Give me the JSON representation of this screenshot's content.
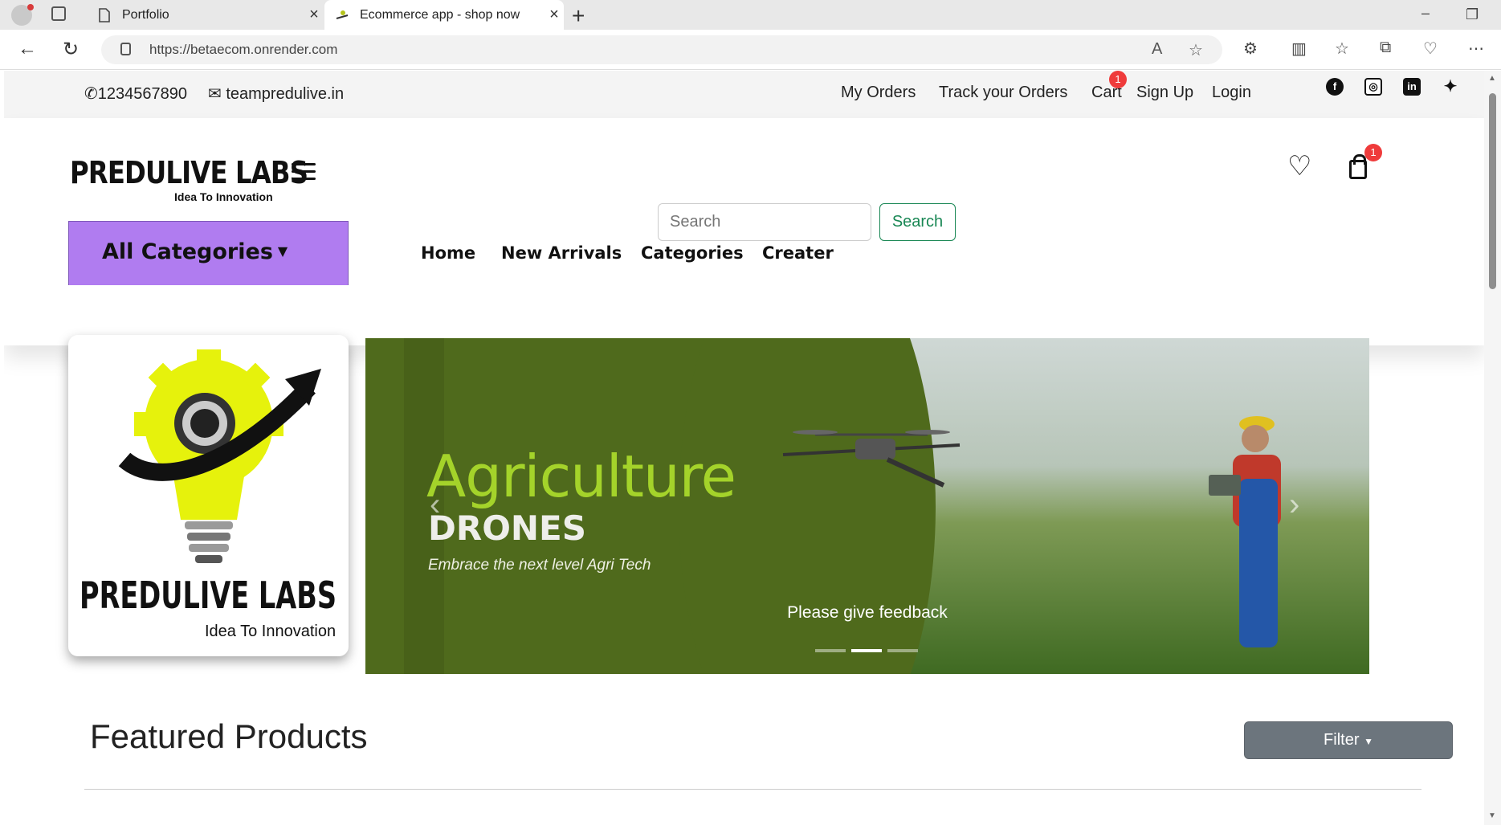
{
  "browser": {
    "tabs": [
      {
        "title": "Portfolio",
        "active": false
      },
      {
        "title": "Ecommerce app - shop now",
        "active": true
      }
    ],
    "url": "https://betaecom.onrender.com"
  },
  "topbar": {
    "phone": "1234567890",
    "email": "teampredulive.in",
    "links": {
      "my_orders": "My Orders",
      "track_orders": "Track your Orders",
      "cart": "Cart",
      "sign_up": "Sign Up",
      "login": "Login"
    },
    "cart_badge": "1",
    "social": [
      "facebook-icon",
      "instagram-icon",
      "linkedin-icon",
      "twitter-icon"
    ]
  },
  "header": {
    "logo_main": "PREDULIVE LABS",
    "logo_sub": "Idea To Innovation",
    "search_placeholder": "Search",
    "search_button": "Search",
    "bag_badge": "1"
  },
  "nav": {
    "all_categories": "All Categories",
    "links": [
      "Home",
      "New Arrivals",
      "Categories",
      "Creater"
    ]
  },
  "hero": {
    "logo_main": "PREDULIVE LABS",
    "logo_sub": "Idea To Innovation",
    "banner_title": "Agriculture",
    "banner_subtitle": "DRONES",
    "banner_tagline": "Embrace the next level Agri Tech",
    "caption": "Please give feedback",
    "active_slide": 2,
    "slide_count": 3
  },
  "featured": {
    "title": "Featured Products",
    "filter_button": "Filter"
  },
  "colors": {
    "accent_purple": "#b07cf0",
    "search_green": "#198754",
    "badge_red": "#ef3b3b",
    "filter_gray": "#6c757d"
  }
}
